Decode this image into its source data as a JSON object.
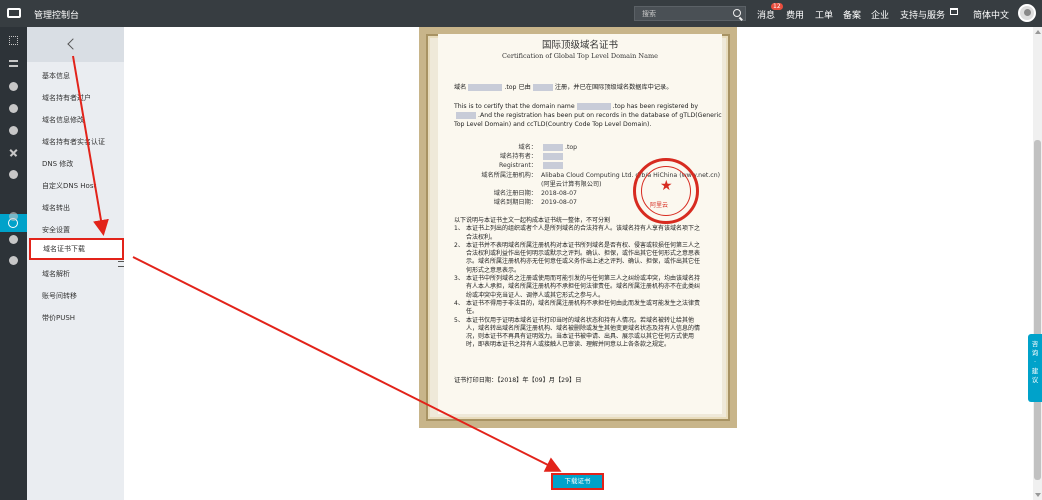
{
  "topbar": {
    "brand": "管理控制台",
    "search_placeholder": "搜索",
    "nav": [
      "消息",
      "费用",
      "工单",
      "备案",
      "企业",
      "支持与服务",
      "简体中文"
    ],
    "message_badge": "12"
  },
  "sidebar": {
    "items": [
      "基本信息",
      "域名持有者过户",
      "域名信息修改",
      "域名持有者实名认证",
      "DNS 修改",
      "自定义DNS Host",
      "域名转出",
      "安全设置",
      "域名证书下载",
      "域名解析",
      "账号间转移",
      "带价PUSH"
    ],
    "active_index": 8
  },
  "certificate": {
    "title_cn": "国际顶级域名证书",
    "title_en": "Certification of Global Top Level Domain Name",
    "line_cn_pre": "域名",
    "line_cn_mid": ".top 已由",
    "line_cn_post": "注册，并已在国际顶级域名数据库中记录。",
    "line_en_a": "This is to certify that the domain name",
    "line_en_b": ".top has been registered by",
    "line_en_c": ".And the registration has been put on records in the database of gTLD(Generic Top Level Domain) and ccTLD(Country Code Top Level Domain).",
    "fields": [
      {
        "k": "域名：",
        "v": ".top"
      },
      {
        "k": "域名持有者：",
        "v": ""
      },
      {
        "k": "Registrant：",
        "v": ""
      },
      {
        "k": "域名所属注册机构：",
        "v": "Alibaba Cloud Computing Ltd. d/b/a HiChina (www.net.cn)"
      },
      {
        "k": "",
        "v": "(阿里云计算有限公司)"
      },
      {
        "k": "域名注册日期：",
        "v": "2018-08-07"
      },
      {
        "k": "域名到期日期：",
        "v": "2019-08-07"
      }
    ],
    "seal_mark": "阿里云",
    "terms_intro": "以下说明与本证书主文一起构成本证书统一整体，不可分割",
    "terms": [
      {
        "n": "1、",
        "t": "本证书上列出的组织或者个人是所列域名的合法持有人。该域名持有人享有该域名项下之合法权利。"
      },
      {
        "n": "2、",
        "t": "本证书并不表明域名所属注册机构对本证书所列域名是否有权、侵害或较损任何第三人之合法权利或利益作出任何明示或默示之评判。确认、担保，或作出其它任何形式之意思表示。域名所属注册机构亦无任何意任或义务作出上述之评判、确认、担保，或作出其它任何形式之意思表示。"
      },
      {
        "n": "3、",
        "t": "本证书中所列域名之注册或使用而可能引发的与任何第三人之纠纷或冲突，均由该域名持有人本人承担，域名所属注册机构不承担任何法律责任。域名所属注册机构亦不在此类纠纷或冲突中充当证人、调停人或其它形式之参与人。"
      },
      {
        "n": "4、",
        "t": "本证书不得用于非法目的，域名所属注册机构不承担任何由此而发生或可能发生之法律责任。"
      },
      {
        "n": "5、",
        "t": "本证书仅用于证明本域名证书打印当时的域名状态和持有人情况。若域名被转让给其他人，域名转出域名所属注册机构、域名被删除或发生其他变更域名状态及持有人信息的情况，则本证书不再具有证明效力。当本证书被申请、出具、展示或以其它任何方式使用时，即表明本证书之持有人或接触人已审读、理解并同意以上各条款之规定。"
      }
    ],
    "print_date": "证书打印日期：【2018】年【09】月【29】日"
  },
  "download_button": "下载证书",
  "feedback": [
    "咨",
    "询",
    "·",
    "建",
    "议"
  ],
  "colors": {
    "topbar": "#373d41",
    "accent": "#00a2ca",
    "highlight": "#e2231a"
  }
}
